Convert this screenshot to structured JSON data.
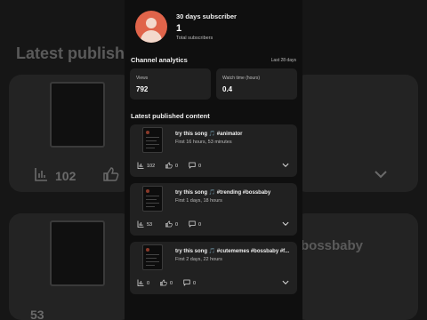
{
  "background": {
    "title": "Latest publish",
    "cards": [
      {
        "views": "102",
        "overlay": ""
      },
      {
        "views": "",
        "overlay": "bossbaby"
      },
      {
        "views": "53",
        "overlay": ""
      }
    ]
  },
  "subscribers": {
    "label": "30 days subscriber",
    "count": "1",
    "caption": "Total subscribers"
  },
  "analytics": {
    "title": "Channel analytics",
    "period": "Last 28 days",
    "metrics": [
      {
        "label": "Views",
        "value": "792"
      },
      {
        "label": "Watch time (hours)",
        "value": "0.4"
      }
    ]
  },
  "latest": {
    "title": "Latest published content",
    "videos": [
      {
        "title": "try this song 🎵 #animator",
        "subtitle": "First 16 hours, 53 minutes",
        "views": "102",
        "likes": "0",
        "comments": "0"
      },
      {
        "title": "try this song 🎵 #trending #bossbaby",
        "subtitle": "First 1 days, 18 hours",
        "views": "53",
        "likes": "0",
        "comments": "0"
      },
      {
        "title": "try this song 🎵 #cutememes #bossbaby #f...",
        "subtitle": "First 2 days, 22 hours",
        "views": "0",
        "likes": "0",
        "comments": "0"
      }
    ]
  },
  "icons": [
    "bar-chart-icon",
    "thumb-up-icon",
    "comment-icon",
    "chevron-down-icon",
    "avatar"
  ],
  "colors": {
    "background": "#0f0f0f",
    "card": "#212121",
    "avatar": "#e0644a",
    "secondary_text": "#bbbbbb"
  }
}
